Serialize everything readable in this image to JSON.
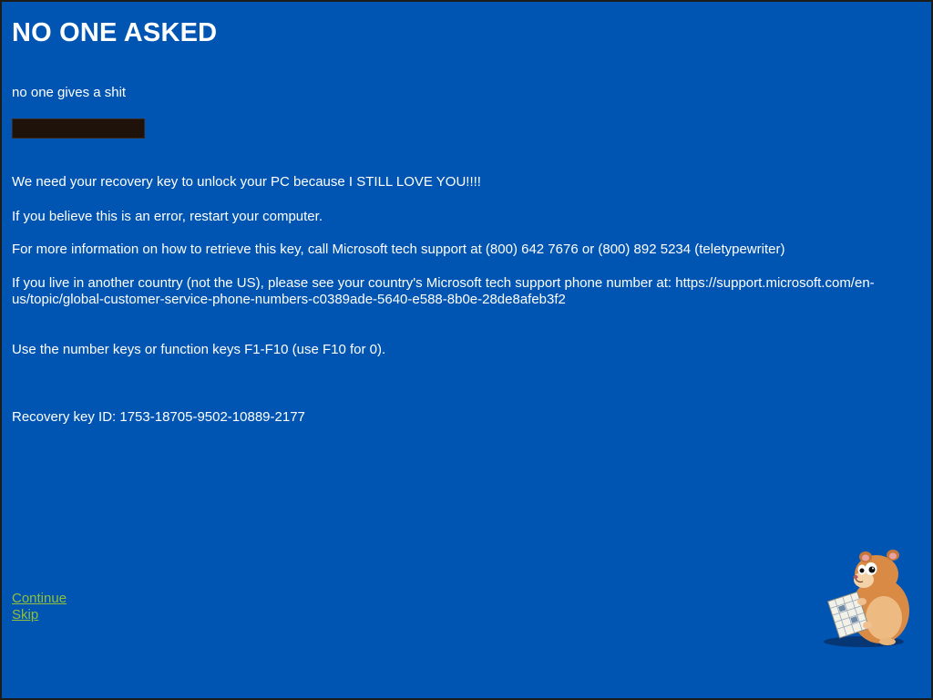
{
  "theme": {
    "background": "#0055b3",
    "text": "#ffffff",
    "link": "#8fbf3a",
    "input_bg": "#1e120a"
  },
  "header": {
    "title": "NO ONE ASKED",
    "subtitle": "no one gives a shit"
  },
  "recovery_input": {
    "value": "",
    "placeholder": ""
  },
  "messages": {
    "unlock": "We need your recovery key to unlock your PC because I STILL LOVE YOU!!!!",
    "error": "If you believe this is an error, restart your computer.",
    "support": "For more information on how to retrieve this key, call Microsoft tech support at (800) 642 7676 or (800) 892 5234 (teletypewriter)",
    "country": "If you live in another country (not the US), please see your country's Microsoft tech support phone number at: https://support.microsoft.com/en-us/topic/global-customer-service-phone-numbers-c0389ade-5640-e588-8b0e-28de8afeb3f2",
    "keys": "Use the number keys or function keys F1-F10 (use F10 for 0).",
    "recovery_id": "Recovery key ID: 1753-18705-9502-10889-2177"
  },
  "links": {
    "continue": "Continue",
    "skip": "Skip"
  },
  "mascot": {
    "icon": "hamster-icon"
  }
}
